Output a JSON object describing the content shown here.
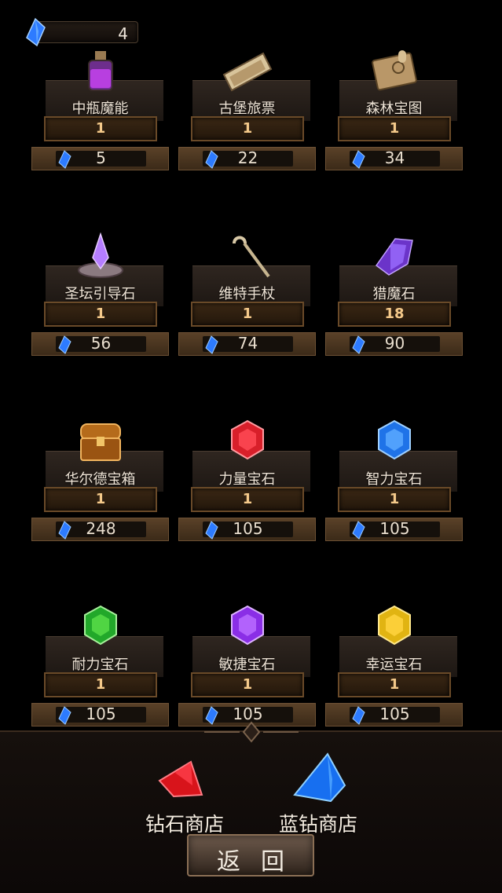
{
  "currency": {
    "value": "4",
    "icon": "blue-diamond-icon"
  },
  "items": [
    {
      "name": "中瓶魔能",
      "qty": "1",
      "price": "5",
      "icon": "potion-bottle-icon"
    },
    {
      "name": "古堡旅票",
      "qty": "1",
      "price": "22",
      "icon": "ticket-icon"
    },
    {
      "name": "森林宝图",
      "qty": "1",
      "price": "34",
      "icon": "treasure-map-icon"
    },
    {
      "name": "圣坛引导石",
      "qty": "1",
      "price": "56",
      "icon": "altar-crystal-icon"
    },
    {
      "name": "维特手杖",
      "qty": "1",
      "price": "74",
      "icon": "cane-staff-icon"
    },
    {
      "name": "猎魔石",
      "qty": "18",
      "price": "90",
      "icon": "purple-crystal-icon"
    },
    {
      "name": "华尔德宝箱",
      "qty": "1",
      "price": "248",
      "icon": "treasure-chest-icon"
    },
    {
      "name": "力量宝石",
      "qty": "1",
      "price": "105",
      "icon": "red-gem-icon"
    },
    {
      "name": "智力宝石",
      "qty": "1",
      "price": "105",
      "icon": "blue-gem-icon"
    },
    {
      "name": "耐力宝石",
      "qty": "1",
      "price": "105",
      "icon": "green-gem-icon"
    },
    {
      "name": "敏捷宝石",
      "qty": "1",
      "price": "105",
      "icon": "purple-gem-icon"
    },
    {
      "name": "幸运宝石",
      "qty": "1",
      "price": "105",
      "icon": "yellow-gem-icon"
    }
  ],
  "shops": {
    "diamond_label": "钻石商店",
    "blue_diamond_label": "蓝钻商店"
  },
  "back_label": "返回",
  "colors": {
    "qty_text": "#f4c98a",
    "red_gem": "#e0202a",
    "blue_gem": "#1f7dff",
    "green_gem": "#2fbf2f",
    "purple_gem": "#9a3cff",
    "yellow_gem": "#f0c21c"
  }
}
